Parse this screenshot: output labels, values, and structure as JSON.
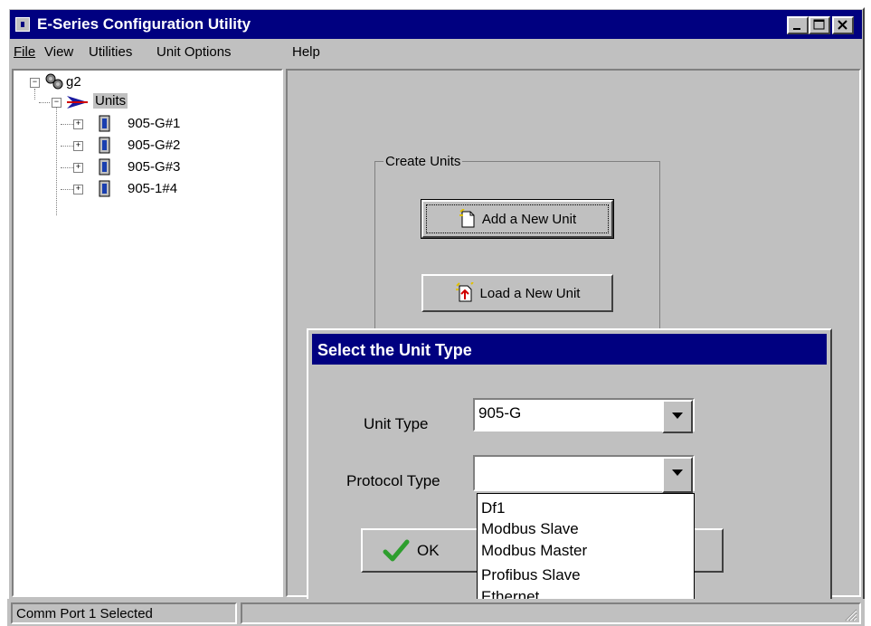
{
  "window": {
    "title": "E-Series Configuration Utility"
  },
  "menubar": {
    "items": [
      "File",
      "View",
      "Utilities",
      "Unit Options",
      "Help"
    ]
  },
  "tree": {
    "root": "g2",
    "group": "Units",
    "units": [
      "905-G#1",
      "905-G#2",
      "905-G#3",
      "905-1#4"
    ]
  },
  "create_units": {
    "title": "Create Units",
    "add_label": "Add a New Unit",
    "load_label": "Load a New Unit"
  },
  "dialog": {
    "title": "Select the Unit Type",
    "unit_type_label": "Unit Type",
    "unit_type_value": "905-G",
    "protocol_type_label": "Protocol Type",
    "protocol_type_value": "",
    "ok_label": "OK",
    "protocol_options": [
      "Df1",
      "Modbus Slave",
      "Modbus Master",
      "Profibus Slave",
      "Ethernet"
    ]
  },
  "statusbar": {
    "text": "Comm Port 1 Selected"
  },
  "colors": {
    "title_bar": "#000080",
    "face": "#c0c0c0",
    "check": "#2e9e2e"
  },
  "icons": [
    "app-icon",
    "minimize-icon",
    "maximize-icon",
    "close-icon",
    "network-gear-icon",
    "arrow-icon",
    "device-icon",
    "new-document-icon",
    "load-document-icon",
    "checkmark-icon",
    "dropdown-arrow-icon",
    "resize-grip-icon"
  ]
}
